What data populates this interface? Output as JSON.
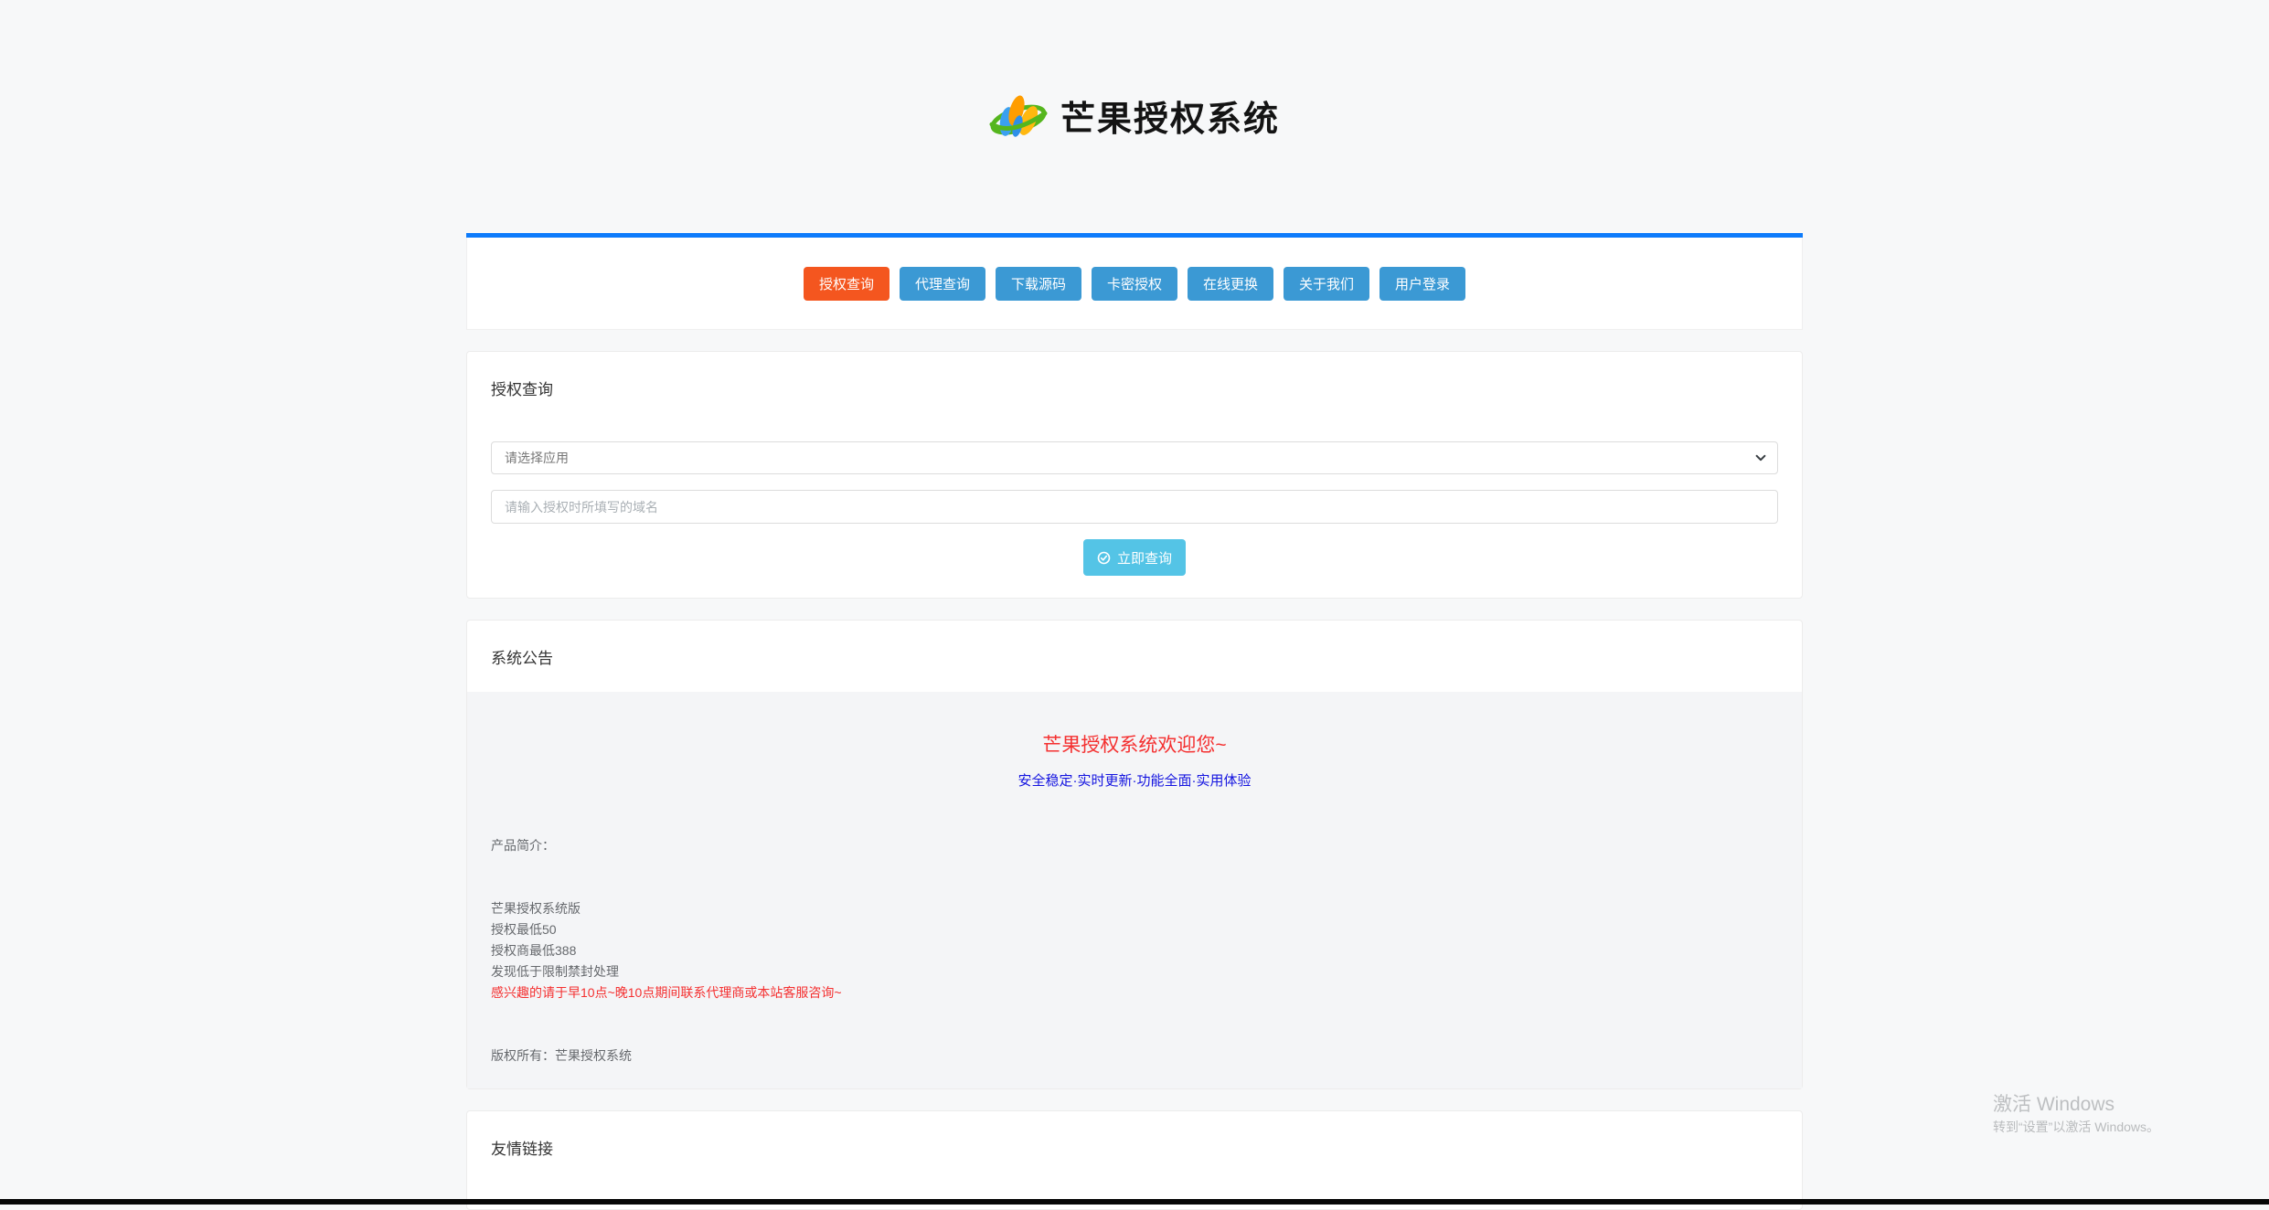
{
  "brand": {
    "title": "芒果授权系统",
    "logo": "mango-logo"
  },
  "colors": {
    "accent_line": "#0d7bfb",
    "nav_button": "#3b99d4",
    "nav_button_active": "#f4561f",
    "submit_button": "#54c4e6",
    "headline_red": "#f43030",
    "tagline_blue": "#1414e0"
  },
  "nav": {
    "items": [
      {
        "label": "授权查询",
        "active": true
      },
      {
        "label": "代理查询",
        "active": false
      },
      {
        "label": "下载源码",
        "active": false
      },
      {
        "label": "卡密授权",
        "active": false
      },
      {
        "label": "在线更换",
        "active": false
      },
      {
        "label": "关于我们",
        "active": false
      },
      {
        "label": "用户登录",
        "active": false
      }
    ]
  },
  "query_card": {
    "title": "授权查询",
    "app_select_value": "请选择应用",
    "domain_placeholder": "请输入授权时所填写的域名",
    "submit_label": "立即查询",
    "submit_icon": "check-circle-icon"
  },
  "announcement_card": {
    "title": "系统公告",
    "headline": "芒果授权系统欢迎您~",
    "tagline": "安全稳定·实时更新·功能全面·实用体验",
    "intro_label": "产品简介：",
    "product_name": "芒果授权系统版",
    "price_lines": [
      "授权最低50",
      "授权商最低388",
      "发现低于限制禁封处理"
    ],
    "contact_line": "感兴趣的请于早10点~晚10点期间联系代理商或本站客服咨询~",
    "copyright_line": "版权所有：芒果授权系统"
  },
  "links_card": {
    "title": "友情链接"
  },
  "watermark": {
    "line1": "激活 Windows",
    "line2": "转到“设置”以激活 Windows。"
  }
}
